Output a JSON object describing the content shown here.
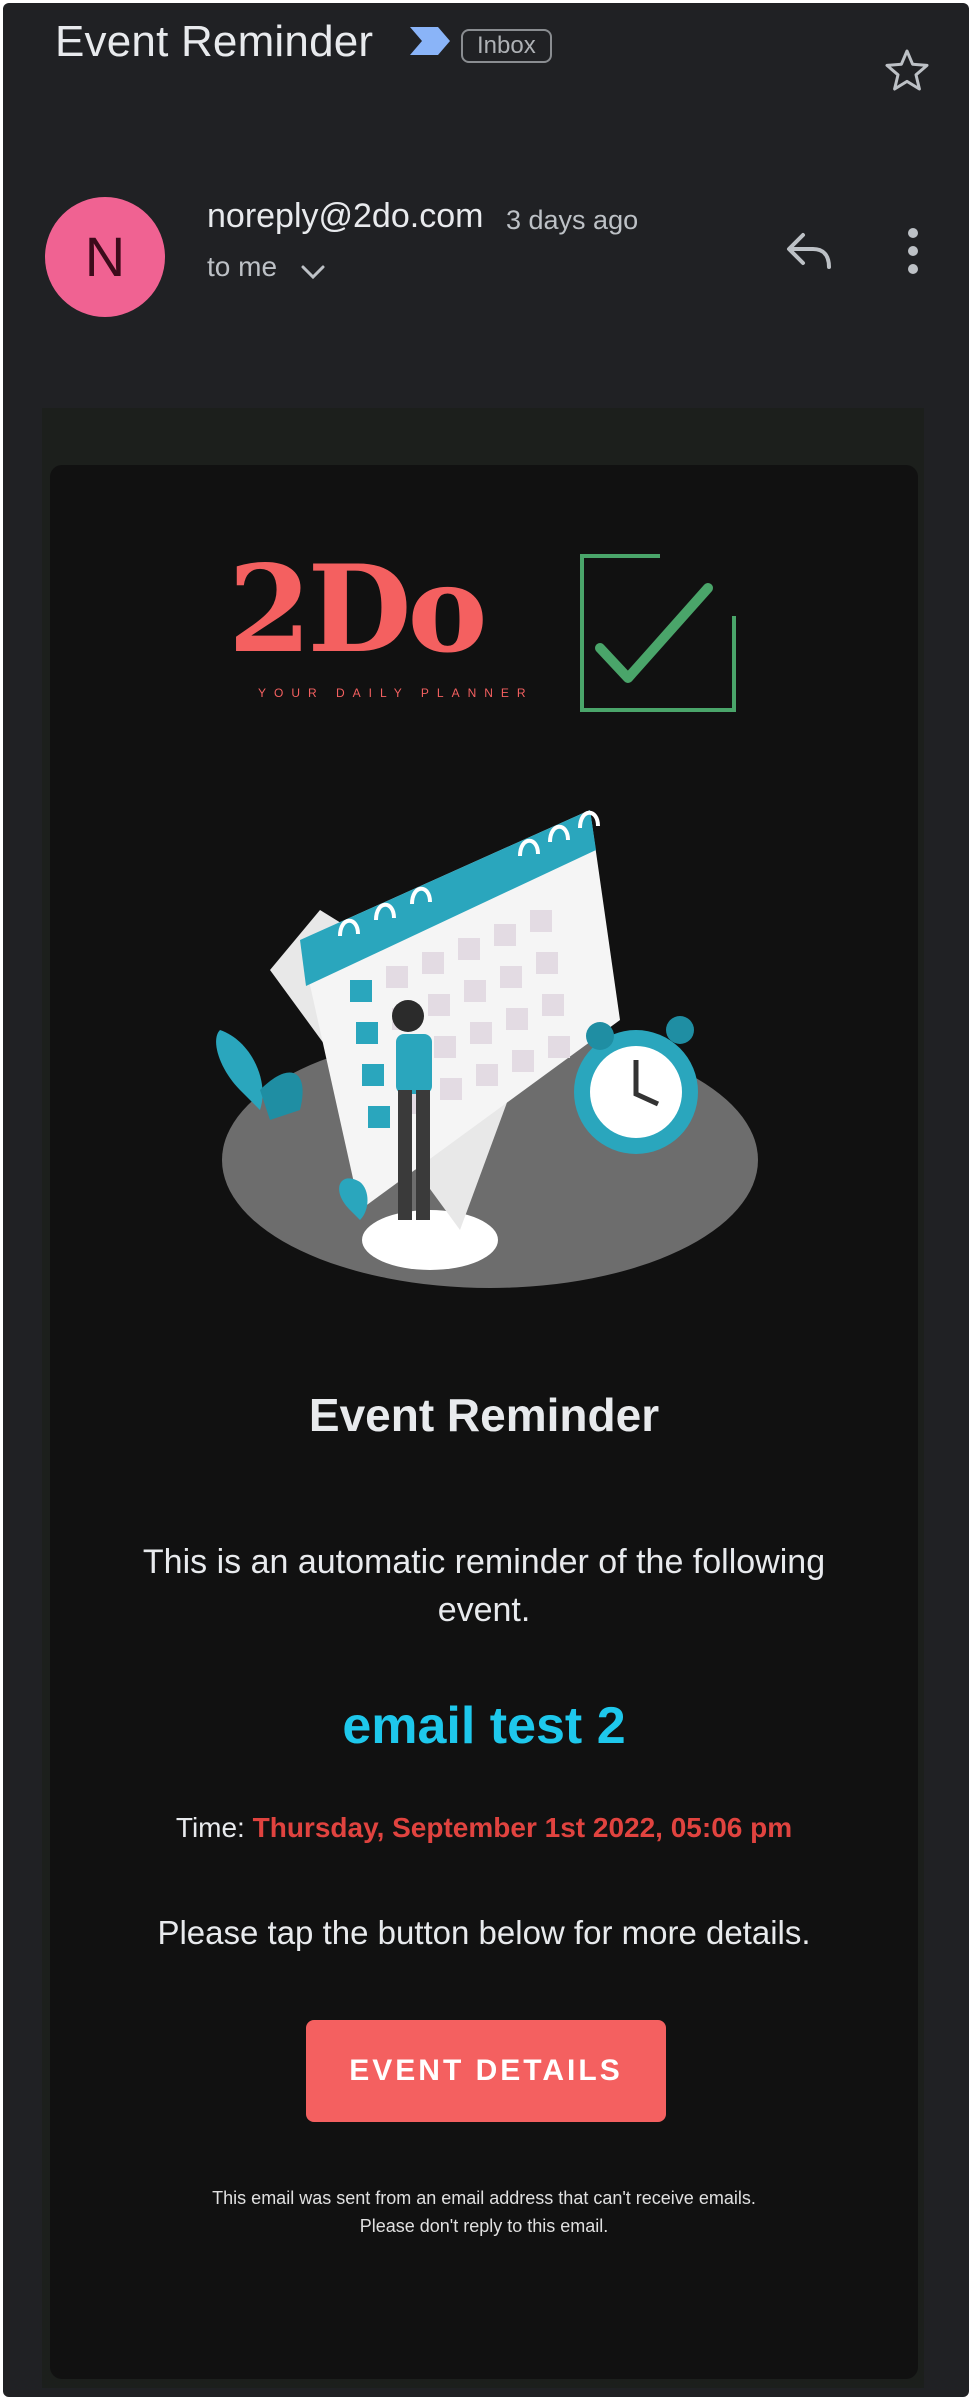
{
  "header": {
    "subject": "Event Reminder",
    "label": "Inbox"
  },
  "message": {
    "sender_initial": "N",
    "sender": "noreply@2do.com",
    "time_ago": "3 days ago",
    "recipient": "to me"
  },
  "email_body": {
    "logo_text": "2Do",
    "logo_tagline": "YOUR DAILY PLANNER",
    "heading": "Event Reminder",
    "intro": "This is an automatic reminder of the following event.",
    "event_name": "email test 2",
    "time_label": "Time:",
    "time_value": "Thursday, September 1st 2022, 05:06 pm",
    "instruction": "Please tap the button below for more details.",
    "button_label": "EVENT DETAILS",
    "footer_line1": "This email was sent from an email address that can't receive emails.",
    "footer_line2": "Please don't reply to this email."
  },
  "colors": {
    "background": "#202124",
    "avatar": "#f06292",
    "brand": "#f46060",
    "event_name": "#1ec8ec",
    "time_value": "#e0433f",
    "check": "#4aa56a"
  },
  "icons": [
    "label-chevron-icon",
    "star-icon",
    "chevron-down-icon",
    "reply-icon",
    "more-vert-icon",
    "checkbox-check-icon"
  ]
}
